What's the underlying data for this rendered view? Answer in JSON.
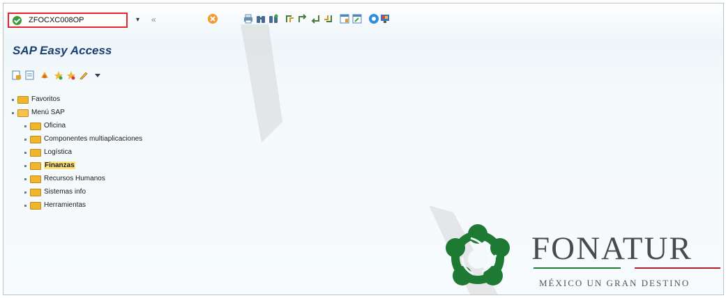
{
  "toolbar": {
    "command_field_value": "ZFOCXC008OP",
    "dropdown_glyph": "▾",
    "collapse_glyph": "«"
  },
  "page": {
    "title": "SAP Easy Access"
  },
  "tree": {
    "nodes": [
      {
        "label": "Favoritos",
        "level": 0,
        "open": false,
        "selected": false
      },
      {
        "label": "Menú SAP",
        "level": 0,
        "open": true,
        "selected": false
      },
      {
        "label": "Oficina",
        "level": 1,
        "open": false,
        "selected": false
      },
      {
        "label": "Componentes multiaplicaciones",
        "level": 1,
        "open": false,
        "selected": false
      },
      {
        "label": "Logística",
        "level": 1,
        "open": false,
        "selected": false
      },
      {
        "label": "Finanzas",
        "level": 1,
        "open": false,
        "selected": true
      },
      {
        "label": "Recursos Humanos",
        "level": 1,
        "open": false,
        "selected": false
      },
      {
        "label": "Sistemas info",
        "level": 1,
        "open": false,
        "selected": false
      },
      {
        "label": "Herramientas",
        "level": 1,
        "open": false,
        "selected": false
      }
    ]
  },
  "logo": {
    "name": "FONATUR",
    "tagline": "MÉXICO UN GRAN DESTINO"
  },
  "colors": {
    "title": "#1b3e73",
    "highlight": "#ffe27a",
    "folder": "#f0b629",
    "logo_green": "#1e7a33",
    "line_green": "#1e7a33",
    "line_red": "#b0202a"
  }
}
